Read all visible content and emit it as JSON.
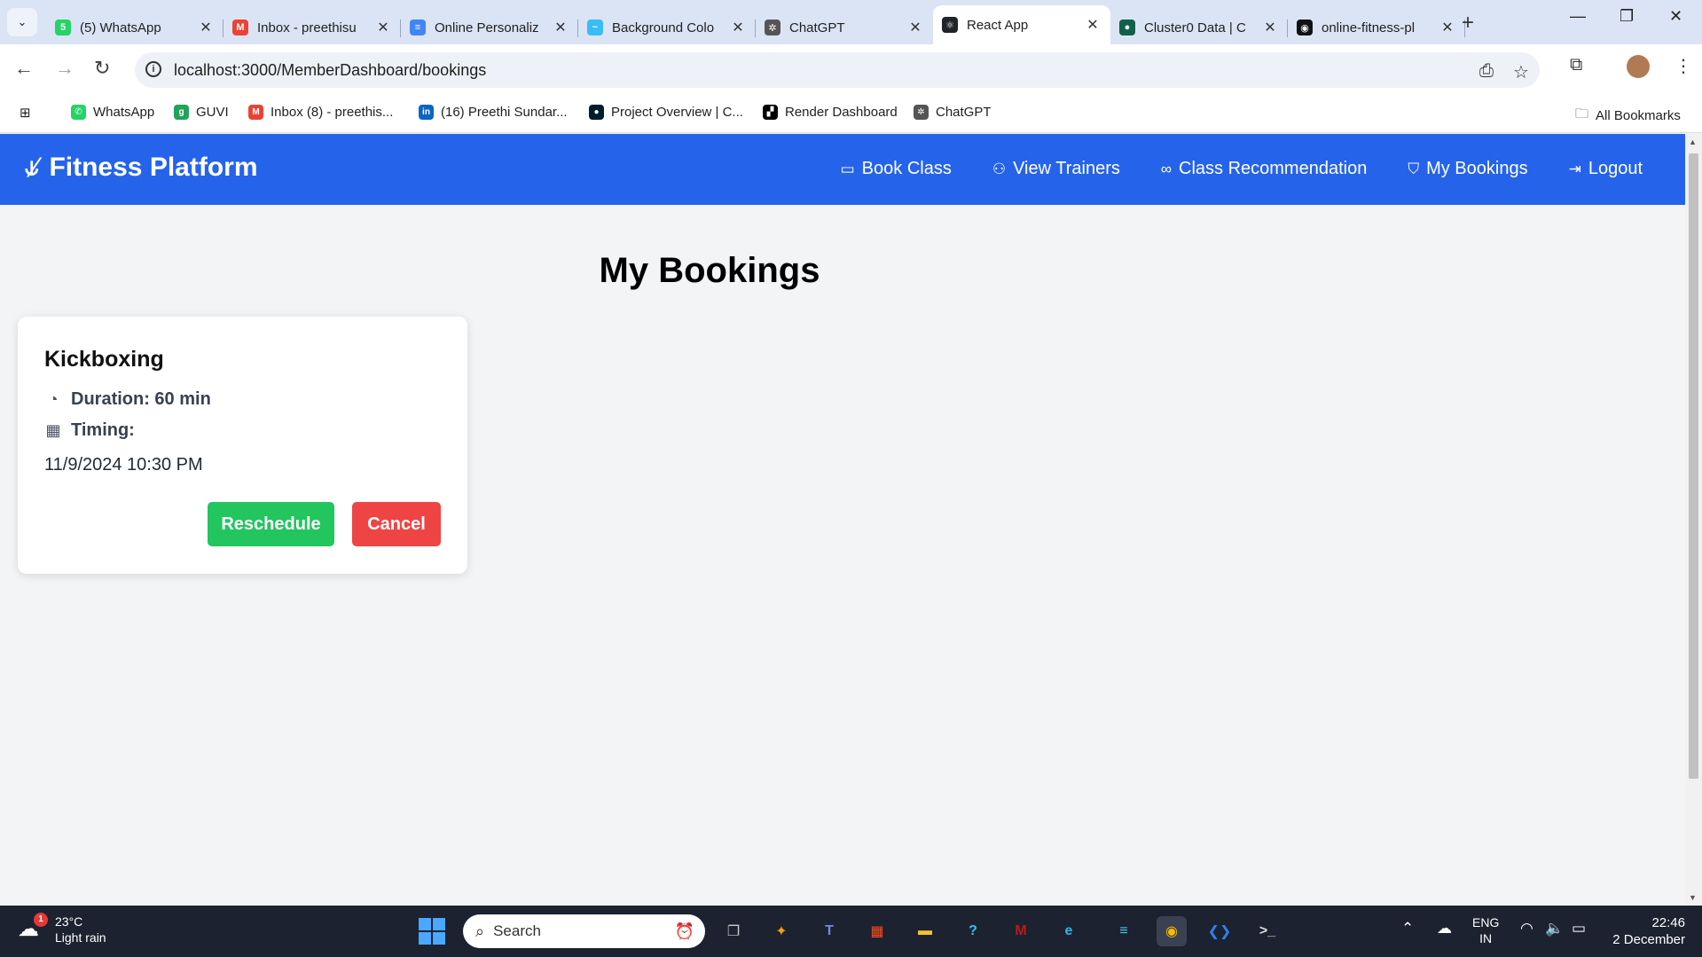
{
  "browser": {
    "tabs": [
      {
        "title": "(5) WhatsApp",
        "favicon": "whatsapp-icon",
        "color": "#25d366",
        "glyph": "5"
      },
      {
        "title": "Inbox - preethisu",
        "favicon": "gmail-icon",
        "color": "#ea4335",
        "glyph": "M"
      },
      {
        "title": "Online Personaliz",
        "favicon": "docs-icon",
        "color": "#4285f4",
        "glyph": "≡"
      },
      {
        "title": "Background Colo",
        "favicon": "tailwind-icon",
        "color": "#38bdf8",
        "glyph": "~"
      },
      {
        "title": "ChatGPT",
        "favicon": "chatgpt-icon",
        "color": "#555555",
        "glyph": "✲"
      },
      {
        "title": "React App",
        "favicon": "react-icon",
        "color": "#20232a",
        "glyph": "⚛",
        "active": true
      },
      {
        "title": "Cluster0 Data | C",
        "favicon": "mongodb-icon",
        "color": "#116149",
        "glyph": "●"
      },
      {
        "title": "online-fitness-pl",
        "favicon": "github-icon",
        "color": "#111111",
        "glyph": "◉"
      }
    ],
    "url": "localhost:3000/MemberDashboard/bookings",
    "bookmarks": [
      {
        "label": "WhatsApp",
        "favicon": "whatsapp-icon",
        "color": "#25d366",
        "glyph": "✆"
      },
      {
        "label": "GUVI",
        "favicon": "guvi-icon",
        "color": "#22a35a",
        "glyph": "g"
      },
      {
        "label": "Inbox (8) - preethis...",
        "favicon": "gmail-icon",
        "color": "#ea4335",
        "glyph": "M"
      },
      {
        "label": "(16) Preethi Sundar...",
        "favicon": "linkedin-icon",
        "color": "#0a66c2",
        "glyph": "in"
      },
      {
        "label": "Project Overview | C...",
        "favicon": "mongodb-icon",
        "color": "#001e2b",
        "glyph": "●"
      },
      {
        "label": "Render Dashboard",
        "favicon": "render-icon",
        "color": "#000000",
        "glyph": "▞"
      },
      {
        "label": "ChatGPT",
        "favicon": "chatgpt-icon",
        "color": "#555555",
        "glyph": "✲"
      }
    ],
    "all_bookmarks": "All Bookmarks"
  },
  "app": {
    "brand": "Fitness Platform",
    "nav": [
      {
        "label": "Book Class",
        "icon": "ticket-icon",
        "glyph": "▭"
      },
      {
        "label": "View Trainers",
        "icon": "user-icon",
        "glyph": "⚇"
      },
      {
        "label": "Class Recommendation",
        "icon": "handshake-icon",
        "glyph": "∞"
      },
      {
        "label": "My Bookings",
        "icon": "bookmark-icon",
        "glyph": "⛉"
      },
      {
        "label": "Logout",
        "icon": "logout-icon",
        "glyph": "⇥"
      }
    ],
    "page_title": "My Bookings",
    "booking": {
      "class_name": "Kickboxing",
      "duration": "Duration: 60 min",
      "timing_label": "Timing:",
      "timing_value": "11/9/2024 10:30 PM",
      "reschedule_label": "Reschedule",
      "cancel_label": "Cancel"
    },
    "colors": {
      "primary": "#2563eb",
      "success": "#22c55e",
      "danger": "#ef4444"
    }
  },
  "taskbar": {
    "weather_temp": "23°C",
    "weather_desc": "Light rain",
    "weather_badge": "1",
    "search_placeholder": "Search",
    "lang_top": "ENG",
    "lang_bottom": "IN",
    "time": "22:46",
    "date": "2 December"
  }
}
